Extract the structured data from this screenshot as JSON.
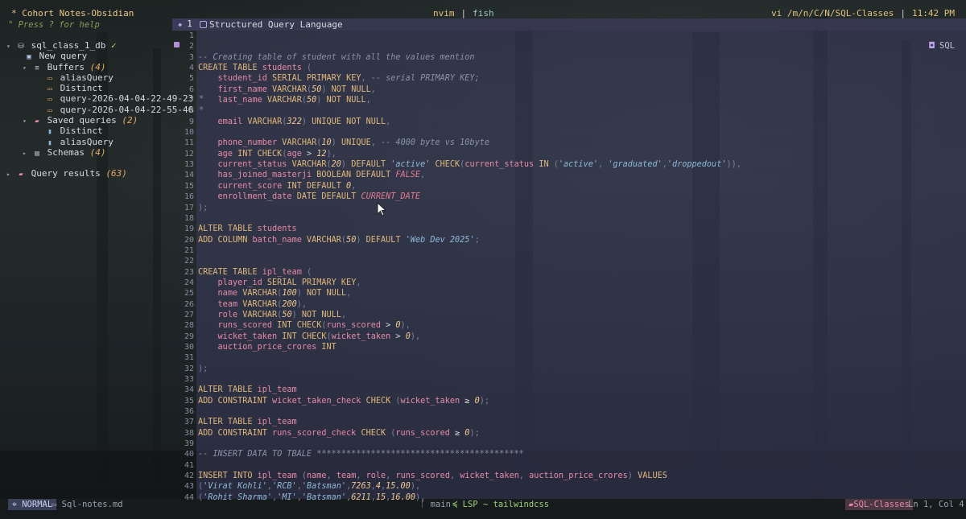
{
  "topbar": {
    "vault_title": "* Cohort Notes-Obsidian",
    "help_hint": "\" Press ? for help",
    "app": "nvim",
    "shell": "fish",
    "path": "vi /m/n/C/N/SQL-Classes",
    "time": "11:42 PM"
  },
  "tree": {
    "db_name": "sql_class_1_db",
    "db_check": "✓",
    "new_query": "New query",
    "buffers_label": "Buffers",
    "buffers_count": "(4)",
    "buffers": [
      "aliasQuery",
      "Distinct",
      "query-2026-04-04-22-49-23 *",
      "query-2026-04-04-22-55-46 *"
    ],
    "saved_label": "Saved queries",
    "saved_count": "(2)",
    "saved": [
      "Distinct",
      "aliasQuery"
    ],
    "schemas_label": "Schemas",
    "schemas_count": "(4)",
    "results_label": "Query results",
    "results_count": "(63)"
  },
  "editor": {
    "tab_number": "1",
    "tab_title": "Structured Query Language",
    "filetype": "SQL",
    "line_numbers": [
      "1",
      "2",
      "3",
      "4",
      "5",
      "6",
      "7",
      "8",
      "9",
      "10",
      "11",
      "12",
      "13",
      "14",
      "15",
      "16",
      "17",
      "18",
      "19",
      "20",
      "21",
      "22",
      "23",
      "24",
      "25",
      "26",
      "27",
      "28",
      "29",
      "30",
      "31",
      "32",
      "33",
      "34",
      "35",
      "36",
      "37",
      "38",
      "39",
      "40",
      "41",
      "42",
      "43",
      "44"
    ],
    "lines": [
      "",
      "",
      "-- Creating table of student with all the values mention",
      "CREATE TABLE students (",
      "    student_id SERIAL PRIMARY KEY, -- serial PRIMARY KEY;",
      "    first_name VARCHAR(50) NOT NULL,",
      "    last_name VARCHAR(50) NOT NULL,",
      "",
      "    email VARCHAR(322) UNIQUE NOT NULL,",
      "",
      "    phone_number VARCHAR(10) UNIQUE, -- 4000 byte vs 10byte",
      "    age INT CHECK(age > 12),",
      "    current_status VARCHAR(20) DEFAULT 'active' CHECK(current_status IN ('active', 'graduated','droppedout')),",
      "    has_joined_masterji BOOLEAN DEFAULT FALSE,",
      "    current_score INT DEFAULT 0,",
      "    enrollment_date DATE DEFAULT CURRENT_DATE",
      ");",
      "",
      "ALTER TABLE students",
      "ADD COLUMN batch_name VARCHAR(50) DEFAULT 'Web Dev 2025';",
      "",
      "",
      "CREATE TABLE ipl_team (",
      "    player_id SERIAL PRIMARY KEY,",
      "    name VARCHAR(100) NOT NULL,",
      "    team VARCHAR(200),",
      "    role VARCHAR(50) NOT NULL,",
      "    runs_scored INT CHECK(runs_scored > 0),",
      "    wicket_taken INT CHECK(wicket_taken > 0),",
      "    auction_price_crores INT",
      "",
      ");",
      "",
      "ALTER TABLE ipl_team",
      "ADD CONSTRAINT wicket_taken_check CHECK (wicket_taken ≥ 0);",
      "",
      "ALTER TABLE ipl_team",
      "ADD CONSTRAINT runs_scored_check CHECK (runs_scored ≥ 0);",
      "",
      "-- INSERT DATA TO TBALE ******************************************",
      "",
      "INSERT INTO ipl_team (name, team, role, runs_scored, wicket_taken, auction_price_crores) VALUES",
      "('Virat Kohli','RCB','Batsman',7263,4,15.00),",
      "('Rohit Sharma','MI','Batsman',6211,15,16.00),"
    ]
  },
  "status": {
    "mode": "NORMAL",
    "file": "Sql-notes.md",
    "branch": "main",
    "lsp": "LSP ~ tailwindcss",
    "project": "SQL-Classes",
    "position": "Ln 1, Col 4"
  }
}
